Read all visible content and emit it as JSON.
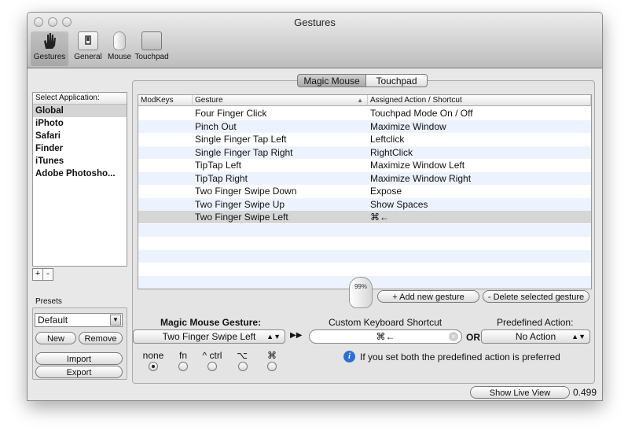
{
  "window": {
    "title": "Gestures"
  },
  "toolbar": {
    "items": [
      {
        "label": "Gestures",
        "icon": "hand-icon"
      },
      {
        "label": "General",
        "icon": "switch-icon"
      },
      {
        "label": "Mouse",
        "icon": "mouse-icon"
      },
      {
        "label": "Touchpad",
        "icon": "touchpad-icon"
      }
    ]
  },
  "sidebar": {
    "header": "Select Application:",
    "items": [
      "Global",
      "iPhoto",
      "Safari",
      "Finder",
      "iTunes",
      "Adobe Photosho..."
    ],
    "add_label": "+",
    "remove_label": "-"
  },
  "presets": {
    "label": "Presets",
    "selected": "Default",
    "new_label": "New",
    "remove_label": "Remove",
    "import_label": "Import",
    "export_label": "Export"
  },
  "device_tabs": [
    "Magic Mouse",
    "Touchpad"
  ],
  "table": {
    "columns": [
      "ModKeys",
      "Gesture",
      "Assigned Action / Shortcut"
    ],
    "sort_indicator": "▲",
    "rows": [
      {
        "modkeys": "",
        "gesture": "Four Finger Click",
        "action": "Touchpad Mode On / Off"
      },
      {
        "modkeys": "",
        "gesture": "Pinch Out",
        "action": "Maximize Window"
      },
      {
        "modkeys": "",
        "gesture": "Single Finger Tap Left",
        "action": "Leftclick"
      },
      {
        "modkeys": "",
        "gesture": "Single Finger Tap Right",
        "action": "RightClick"
      },
      {
        "modkeys": "",
        "gesture": "TipTap Left",
        "action": "Maximize Window Left"
      },
      {
        "modkeys": "",
        "gesture": "TipTap Right",
        "action": "Maximize Window Right"
      },
      {
        "modkeys": "",
        "gesture": "Two Finger Swipe Down",
        "action": "Expose"
      },
      {
        "modkeys": "",
        "gesture": "Two Finger Swipe Up",
        "action": "Show Spaces"
      },
      {
        "modkeys": "",
        "gesture": "Two Finger Swipe Left",
        "action": "⌘←"
      }
    ],
    "selected_row": 8
  },
  "buttons": {
    "add_gesture": "+ Add new gesture",
    "delete_gesture": "- Delete selected gesture",
    "show_live_view": "Show Live View"
  },
  "mouse_badge": "99%",
  "editor": {
    "gesture_label": "Magic Mouse Gesture:",
    "gesture_value": "Two Finger Swipe Left",
    "shortcut_label": "Custom Keyboard Shortcut",
    "shortcut_value": "⌘←",
    "or_label": "OR",
    "predefined_label": "Predefined Action:",
    "predefined_value": "No Action",
    "arrows": "▶▶",
    "mods": [
      "none",
      "fn",
      "^ ctrl",
      "⌥",
      "⌘"
    ],
    "selected_mod": 0,
    "info_text": "If you set both the predefined action is preferred"
  },
  "version": "0.499",
  "colors": {
    "selected_row": "#d6d6d6",
    "alt_row": "#edf3fe",
    "info_blue": "#2b6fd6"
  }
}
